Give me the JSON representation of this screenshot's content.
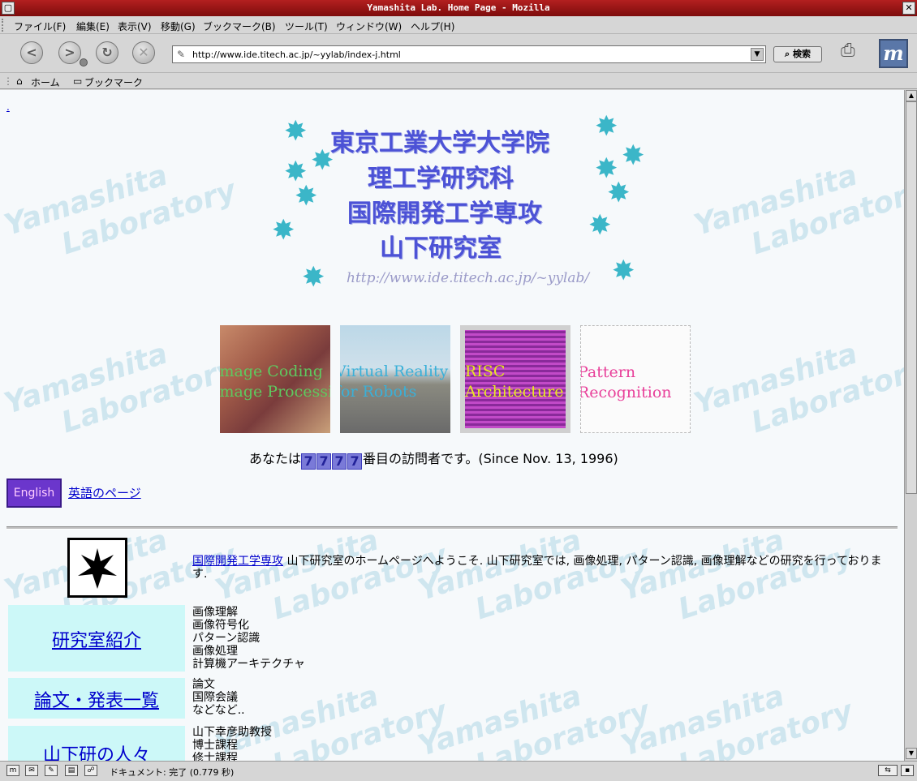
{
  "window": {
    "title": "Yamashita Lab. Home Page - Mozilla"
  },
  "menu": [
    "ファイル(F)",
    "編集(E)",
    "表示(V)",
    "移動(G)",
    "ブックマーク(B)",
    "ツール(T)",
    "ウィンドウ(W)",
    "ヘルプ(H)"
  ],
  "nav": {
    "url": "http://www.ide.titech.ac.jp/~yylab/index-j.html",
    "search_label": "検索"
  },
  "personal_toolbar": {
    "home": "ホーム",
    "bookmarks": "ブックマーク"
  },
  "page": {
    "dot_link": ".",
    "watermark_line1": "Yamashita",
    "watermark_line2": "Laboratory",
    "banner_lines": [
      "東京工業大学大学院",
      "理工学研究科",
      "国際開発工学専攻",
      "山下研究室"
    ],
    "banner_url": "http://www.ide.titech.ac.jp/~yylab/",
    "thumbnails": [
      {
        "line1": "Image Coding",
        "line2": "Image Processing",
        "color": "#5fc85f"
      },
      {
        "line1": "Virtual Reality",
        "line2": "for Robots",
        "color": "#3ab0d8"
      },
      {
        "line1": "RISC",
        "line2": "Architecture",
        "color": "#e8e820"
      },
      {
        "line1": "Pattern",
        "line2": "Recognition",
        "color": "#e8409a"
      }
    ],
    "counter_prefix": "あなたは",
    "counter_digits": [
      "7",
      "7",
      "7",
      "7"
    ],
    "counter_suffix": "番目の訪問者です。(Since Nov. 13, 1996)",
    "english_button": "English",
    "english_link": "英語のページ",
    "intro_link": "国際開発工学専攻",
    "intro_text": " 山下研究室のホームページへようこそ. 山下研究室では, 画像処理, パターン認識, 画像理解などの研究を行っております.",
    "sections": [
      {
        "title": "研究室紹介 ",
        "items": [
          "画像理解",
          "画像符号化",
          "パターン認識",
          "画像処理",
          "計算機アーキテクチャ"
        ]
      },
      {
        "title": "論文・発表一覧 ",
        "items": [
          "論文",
          "国際会議",
          "などなど.."
        ]
      },
      {
        "title": "山下研の人々",
        "items": [
          "山下幸彦助教授",
          "博士課程",
          "修士課程"
        ]
      }
    ]
  },
  "status": {
    "text": "ドキュメント: 完了 (0.779 秒)"
  },
  "colors": {
    "titlebar": "#9a1616",
    "link": "#0000cc",
    "banner_text": "#4c52d6",
    "star": "#3bb6c8",
    "navbox_bg": "#ccf8f8",
    "watermark": "#cfe6ef"
  }
}
